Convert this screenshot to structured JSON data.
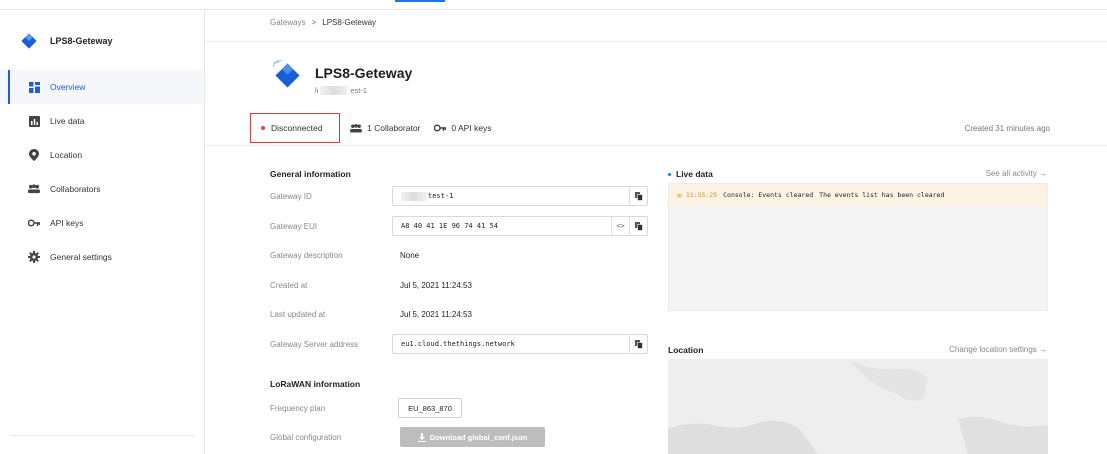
{
  "sidebar": {
    "gateway_name": "LPS8-Geteway",
    "items": [
      {
        "label": "Overview",
        "icon": "grid-icon",
        "active": true
      },
      {
        "label": "Live data",
        "icon": "chart-icon"
      },
      {
        "label": "Location",
        "icon": "location-pin-icon"
      },
      {
        "label": "Collaborators",
        "icon": "people-icon"
      },
      {
        "label": "API keys",
        "icon": "key-icon"
      },
      {
        "label": "General settings",
        "icon": "gear-icon"
      }
    ]
  },
  "breadcrumb": {
    "root": "Gateways",
    "separator": ">",
    "current": "LPS8-Geteway"
  },
  "header": {
    "title": "LPS8-Geteway",
    "subtitle_prefix": "li",
    "subtitle_suffix": "est-1",
    "status": "Disconnected",
    "collaborators": "1 Collaborator",
    "api_keys": "0 API keys",
    "created_ago": "Created 31 minutes ago"
  },
  "general": {
    "title": "General information",
    "fields": {
      "gateway_id": {
        "label": "Gateway ID",
        "value": "test-1"
      },
      "gateway_eui": {
        "label": "Gateway EUI",
        "value": "A8 40 41 1E 96 74 41 54"
      },
      "description": {
        "label": "Gateway description",
        "value": "None"
      },
      "created_at": {
        "label": "Created at",
        "value": "Jul 5, 2021 11:24:53"
      },
      "updated_at": {
        "label": "Last updated at",
        "value": "Jul 5, 2021 11:24:53"
      },
      "server_address": {
        "label": "Gateway Server address",
        "value": "eu1.cloud.thethings.network"
      }
    }
  },
  "lorawan": {
    "title": "LoRaWAN information",
    "frequency_label": "Frequency plan",
    "frequency_value": "EU_863_870",
    "global_conf_label": "Global configuration",
    "download_label": "Download global_conf.json"
  },
  "live_data": {
    "title": "Live data",
    "see_all": "See all activity →",
    "events": [
      {
        "time": "11:55:25",
        "type": "Console: Events cleared",
        "message": "The events list has been cleared"
      }
    ]
  },
  "location": {
    "title": "Location",
    "change": "Change location settings →"
  },
  "colors": {
    "accent": "#1a5fd8",
    "status_red": "#e03a3a",
    "event_bg": "#fdf3e4"
  }
}
